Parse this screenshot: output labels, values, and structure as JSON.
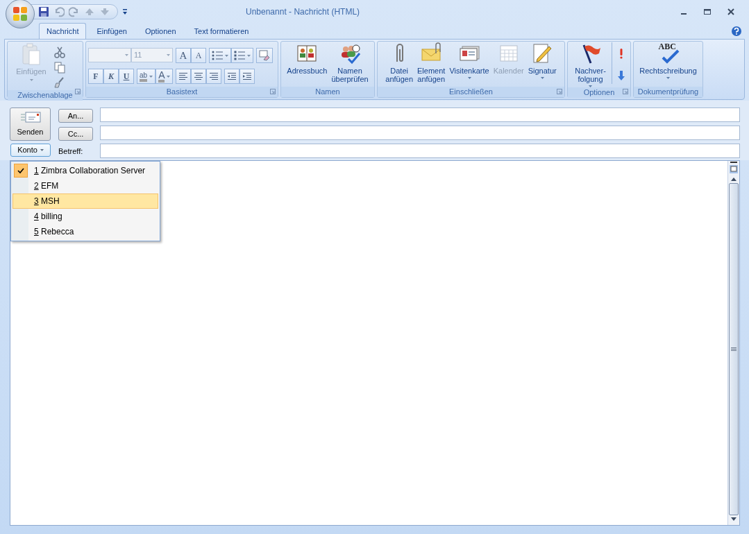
{
  "window": {
    "title": "Unbenannt - Nachricht (HTML)"
  },
  "tabs": [
    {
      "label": "Nachricht",
      "selected": true
    },
    {
      "label": "Einfügen",
      "selected": false
    },
    {
      "label": "Optionen",
      "selected": false
    },
    {
      "label": "Text formatieren",
      "selected": false
    }
  ],
  "ribbon": {
    "clipboard": {
      "label": "Zwischenablage",
      "paste": {
        "label": "Einfügen",
        "disabled": true
      }
    },
    "basic_text": {
      "label": "Basistext",
      "font_size": "11",
      "grow_font": "A",
      "shrink_font": "A",
      "format_buttons": [
        "F",
        "K",
        "U"
      ],
      "highlight": "ab",
      "font_color": "A"
    },
    "groups": [
      {
        "label": "Namen",
        "launcher": false,
        "items": [
          {
            "label": "Adressbuch",
            "disabled": false,
            "dropdown": false
          },
          {
            "label": "Namen überprüfen",
            "disabled": false,
            "dropdown": false
          }
        ]
      },
      {
        "label": "Einschließen",
        "launcher": true,
        "items": [
          {
            "label": "Datei anfügen",
            "disabled": false,
            "dropdown": false
          },
          {
            "label": "Element anfügen",
            "disabled": false,
            "dropdown": false
          },
          {
            "label": "Visitenkarte",
            "disabled": false,
            "dropdown": true
          },
          {
            "label": "Kalender",
            "disabled": true,
            "dropdown": false
          },
          {
            "label": "Signatur",
            "disabled": false,
            "dropdown": true
          }
        ]
      },
      {
        "label": "Optionen",
        "launcher": true,
        "items": [
          {
            "label": "Nachver-folgung",
            "disabled": false,
            "dropdown": true
          }
        ]
      },
      {
        "label": "Dokumentprüfung",
        "launcher": false,
        "items": [
          {
            "label": "Rechtschreibung",
            "disabled": false,
            "dropdown": true,
            "icon_text": "ABC"
          }
        ]
      }
    ]
  },
  "compose": {
    "send": "Senden",
    "recipients": [
      {
        "button": "An..."
      },
      {
        "button": "Cc..."
      }
    ],
    "account": "Konto",
    "subject_label": "Betreff:"
  },
  "account_menu": [
    {
      "key": "1",
      "label": "Zimbra Collaboration Server",
      "checked": true,
      "selected": false
    },
    {
      "key": "2",
      "label": "EFM",
      "checked": false,
      "selected": false
    },
    {
      "key": "3",
      "label": "MSH",
      "checked": false,
      "selected": true
    },
    {
      "key": "4",
      "label": "billing",
      "checked": false,
      "selected": false
    },
    {
      "key": "5",
      "label": "Rebecca",
      "checked": false,
      "selected": false
    }
  ]
}
